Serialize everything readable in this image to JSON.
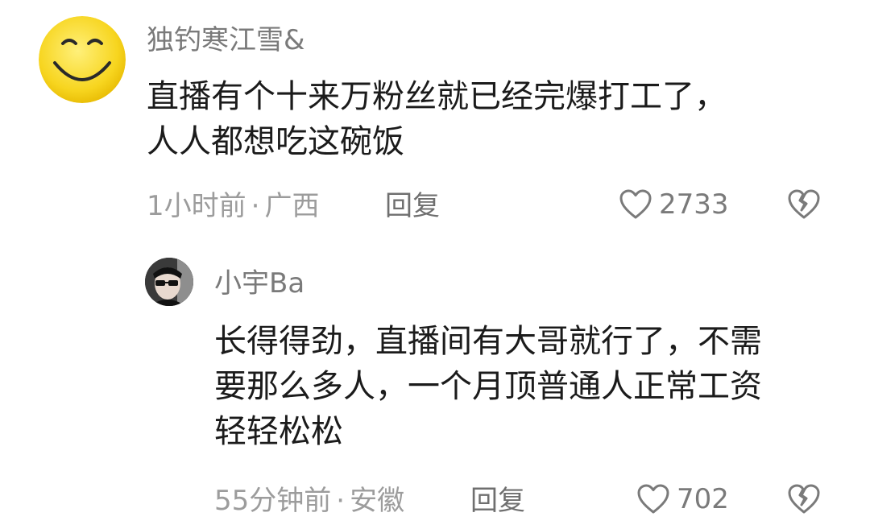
{
  "comments": [
    {
      "username": "独钓寒江雪&",
      "text": "直播有个十来万粉丝就已经完爆打工了，\n人人都想吃这碗饭",
      "time": "1小时前",
      "separator": "·",
      "location": "广西",
      "reply_label": "回复",
      "likes": "2733",
      "avatar_icon": "smiley-face-icon"
    },
    {
      "username": "小宇Ba",
      "text": "长得得劲，直播间有大哥就行了，不需\n要那么多人，一个月顶普通人正常工资\n轻轻松松",
      "time": "55分钟前",
      "separator": "·",
      "location": "安徽",
      "reply_label": "回复",
      "likes": "702",
      "avatar_icon": "sunglasses-person-avatar"
    }
  ],
  "colors": {
    "text": "#1b1b1b",
    "username": "#7a7a7a",
    "meta": "#9c9c9c",
    "avatar_yellow": "#f7d51f"
  }
}
